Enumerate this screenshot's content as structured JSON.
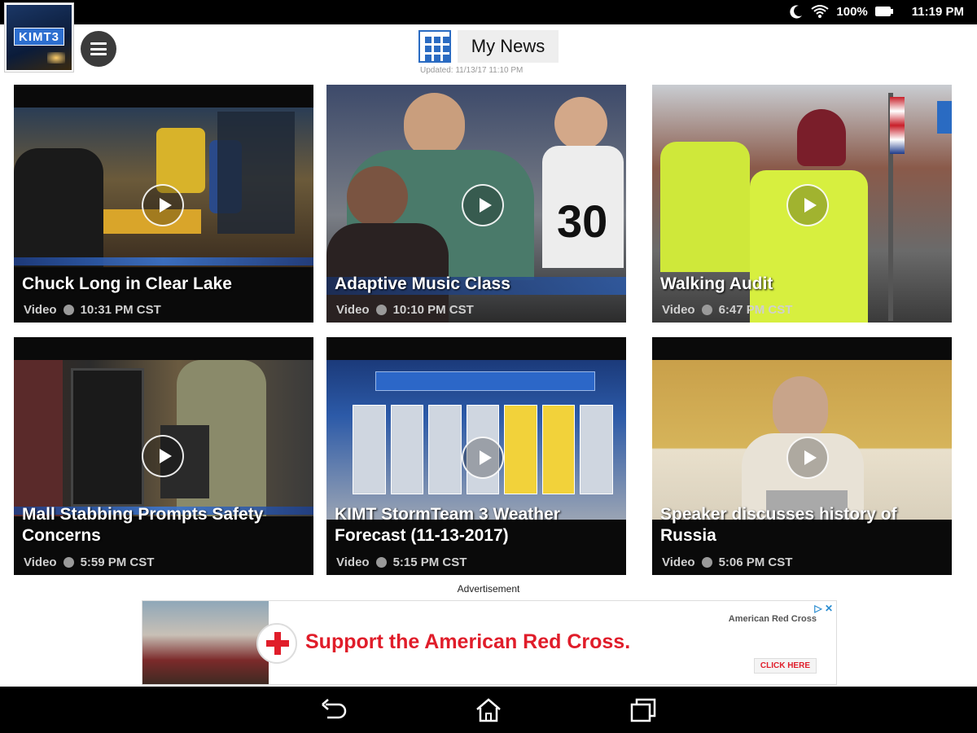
{
  "status_bar": {
    "battery": "100%",
    "time": "11:19 PM",
    "icons": [
      "notification-icon",
      "download-icon",
      "moon-icon",
      "wifi-icon",
      "battery-icon"
    ]
  },
  "header": {
    "logo_text": "KIMT3",
    "title": "My News",
    "updated": "Updated: 11/13/17 11:10 PM"
  },
  "tiles": [
    {
      "title": "Chuck Long in Clear Lake",
      "type": "Video",
      "time": "10:31 PM CST"
    },
    {
      "title": "Adaptive Music Class",
      "type": "Video",
      "time": "10:10 PM CST"
    },
    {
      "title": "Walking Audit",
      "type": "Video",
      "time": "6:47 PM CST"
    },
    {
      "title": "Mall Stabbing Prompts Safety Concerns",
      "type": "Video",
      "time": "5:59 PM CST"
    },
    {
      "title": "KIMT StormTeam 3 Weather Forecast (11-13-2017)",
      "type": "Video",
      "time": "5:15 PM CST"
    },
    {
      "title": "Speaker discusses history of Russia",
      "type": "Video",
      "time": "5:06 PM CST"
    }
  ],
  "ad": {
    "label": "Advertisement",
    "headline": "Support the American Red Cross.",
    "brand": "American Red Cross",
    "cta": "CLICK HERE"
  },
  "colors": {
    "accent_blue": "#2a6bc2",
    "ad_red": "#e01d2a",
    "bar_black": "#000000"
  }
}
